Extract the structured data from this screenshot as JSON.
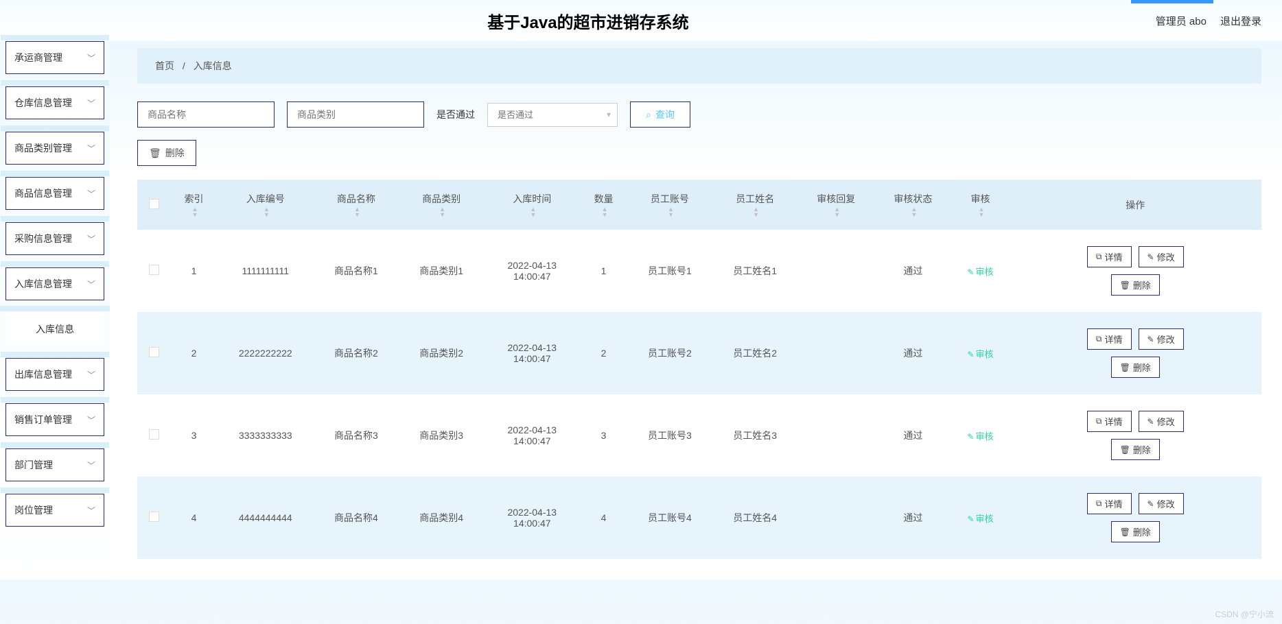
{
  "header": {
    "title": "基于Java的超市进销存系统",
    "user_label": "管理员 abo",
    "logout": "退出登录"
  },
  "sidebar": [
    {
      "label": "承运商管理",
      "collapsible": true
    },
    {
      "label": "仓库信息管理",
      "collapsible": true
    },
    {
      "label": "商品类别管理",
      "collapsible": true
    },
    {
      "label": "商品信息管理",
      "collapsible": true
    },
    {
      "label": "采购信息管理",
      "collapsible": true
    },
    {
      "label": "入库信息管理",
      "collapsible": true
    },
    {
      "label": "入库信息",
      "collapsible": false
    },
    {
      "label": "出库信息管理",
      "collapsible": true
    },
    {
      "label": "销售订单管理",
      "collapsible": true
    },
    {
      "label": "部门管理",
      "collapsible": true
    },
    {
      "label": "岗位管理",
      "collapsible": true
    }
  ],
  "breadcrumb": {
    "home": "首页",
    "sep": "/",
    "current": "入库信息"
  },
  "search": {
    "product_name_ph": "商品名称",
    "product_cat_ph": "商品类别",
    "pass_label": "是否通过",
    "pass_ph": "是否通过",
    "query_btn": "查询"
  },
  "actions": {
    "delete": "删除"
  },
  "table": {
    "headers": [
      "索引",
      "入库编号",
      "商品名称",
      "商品类别",
      "入库时间",
      "数量",
      "员工账号",
      "员工姓名",
      "审核回复",
      "审核状态",
      "审核",
      "操作"
    ],
    "ops": {
      "detail": "详情",
      "edit": "修改",
      "delete": "删除",
      "audit": "审核"
    },
    "rows": [
      {
        "idx": "1",
        "code": "1111111111",
        "name": "商品名称1",
        "cat": "商品类别1",
        "time": "2022-04-13 14:00:47",
        "qty": "1",
        "emp_no": "员工账号1",
        "emp_name": "员工姓名1",
        "reply": "",
        "status": "通过"
      },
      {
        "idx": "2",
        "code": "2222222222",
        "name": "商品名称2",
        "cat": "商品类别2",
        "time": "2022-04-13 14:00:47",
        "qty": "2",
        "emp_no": "员工账号2",
        "emp_name": "员工姓名2",
        "reply": "",
        "status": "通过"
      },
      {
        "idx": "3",
        "code": "3333333333",
        "name": "商品名称3",
        "cat": "商品类别3",
        "time": "2022-04-13 14:00:47",
        "qty": "3",
        "emp_no": "员工账号3",
        "emp_name": "员工姓名3",
        "reply": "",
        "status": "通过"
      },
      {
        "idx": "4",
        "code": "4444444444",
        "name": "商品名称4",
        "cat": "商品类别4",
        "time": "2022-04-13 14:00:47",
        "qty": "4",
        "emp_no": "员工账号4",
        "emp_name": "员工姓名4",
        "reply": "",
        "status": "通过"
      }
    ]
  },
  "watermark": "CSDN @宁小流"
}
